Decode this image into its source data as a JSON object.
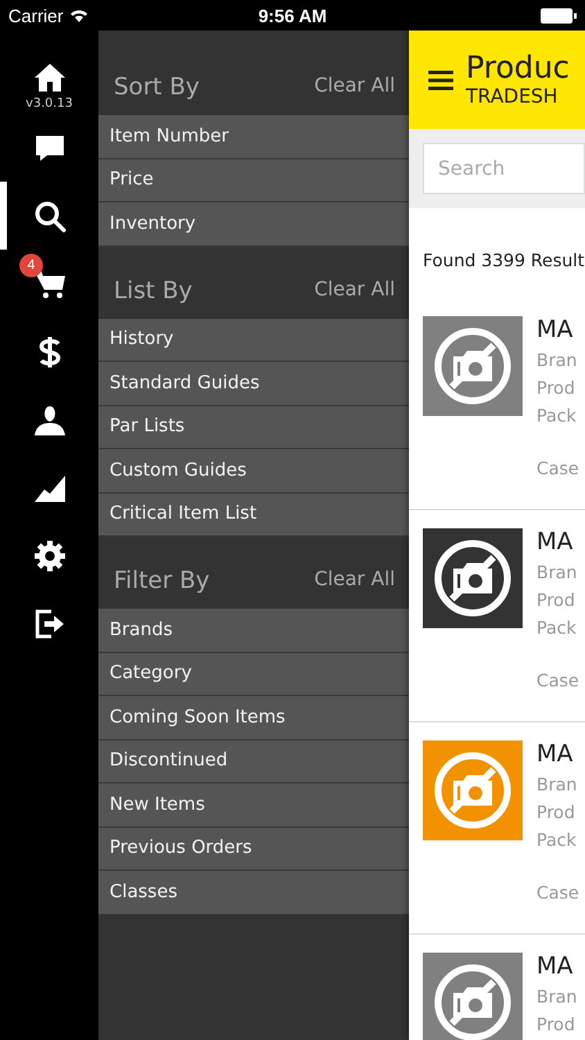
{
  "status_bar": {
    "carrier": "Carrier",
    "time": "9:56 AM"
  },
  "rail": {
    "version": "v3.0.13",
    "items": [
      {
        "kind": "home",
        "selected": false
      },
      {
        "kind": "chat",
        "selected": false
      },
      {
        "kind": "search",
        "selected": true
      },
      {
        "kind": "cart",
        "selected": false,
        "badge": "4"
      },
      {
        "kind": "dollar",
        "selected": false
      },
      {
        "kind": "person",
        "selected": false
      },
      {
        "kind": "chart",
        "selected": false
      },
      {
        "kind": "gear",
        "selected": false
      },
      {
        "kind": "logout",
        "selected": false
      }
    ]
  },
  "filter_panel": {
    "sections": [
      {
        "title": "Sort By",
        "action": "Clear All",
        "items": [
          "Item Number",
          "Price",
          "Inventory"
        ]
      },
      {
        "title": "List By",
        "action": "Clear All",
        "items": [
          "History",
          "Standard Guides",
          "Par Lists",
          "Custom Guides",
          "Critical Item List"
        ]
      },
      {
        "title": "Filter By",
        "action": "Clear All",
        "items": [
          "Brands",
          "Category",
          "Coming Soon Items",
          "Discontinued",
          "New Items",
          "Previous Orders",
          "Classes"
        ]
      }
    ]
  },
  "main": {
    "title": "Produc",
    "subtitle": "TRADESH",
    "search": {
      "placeholder": "Search"
    },
    "results_count": "Found 3399 Result",
    "products": [
      {
        "name": "MA",
        "brand": "Bran",
        "product": "Prod",
        "pack": "Pack",
        "unit": "Case",
        "color": "#808080"
      },
      {
        "name": "MA",
        "brand": "Bran",
        "product": "Prod",
        "pack": "Pack",
        "unit": "Case",
        "color": "#333333"
      },
      {
        "name": "MA",
        "brand": "Bran",
        "product": "Prod",
        "pack": "Pack",
        "unit": "Case",
        "color": "#f39200"
      },
      {
        "name": "MA",
        "brand": "Bran",
        "product": "Prod",
        "color": "#808080"
      }
    ]
  }
}
